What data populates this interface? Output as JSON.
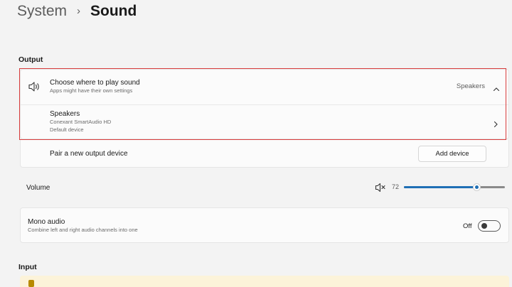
{
  "breadcrumb": {
    "parent": "System",
    "separator": "›",
    "current": "Sound"
  },
  "output": {
    "section_label": "Output",
    "choose": {
      "title": "Choose where to play sound",
      "subtitle": "Apps might have their own settings",
      "selected_value": "Speakers"
    },
    "device": {
      "name": "Speakers",
      "driver": "Conexant SmartAudio HD",
      "status": "Default device"
    },
    "pair": {
      "label": "Pair a new output device",
      "button_label": "Add device"
    }
  },
  "volume": {
    "label": "Volume",
    "value": "72",
    "level_percent": 72,
    "muted_icon": "speaker-muted-icon"
  },
  "mono_audio": {
    "title": "Mono audio",
    "subtitle": "Combine left and right audio channels into one",
    "state_label": "Off",
    "enabled": false
  },
  "input": {
    "section_label": "Input"
  },
  "colors": {
    "accent": "#1f6fb5",
    "highlight_border": "#d93d3d",
    "warning_bg": "#fcf3d9"
  }
}
